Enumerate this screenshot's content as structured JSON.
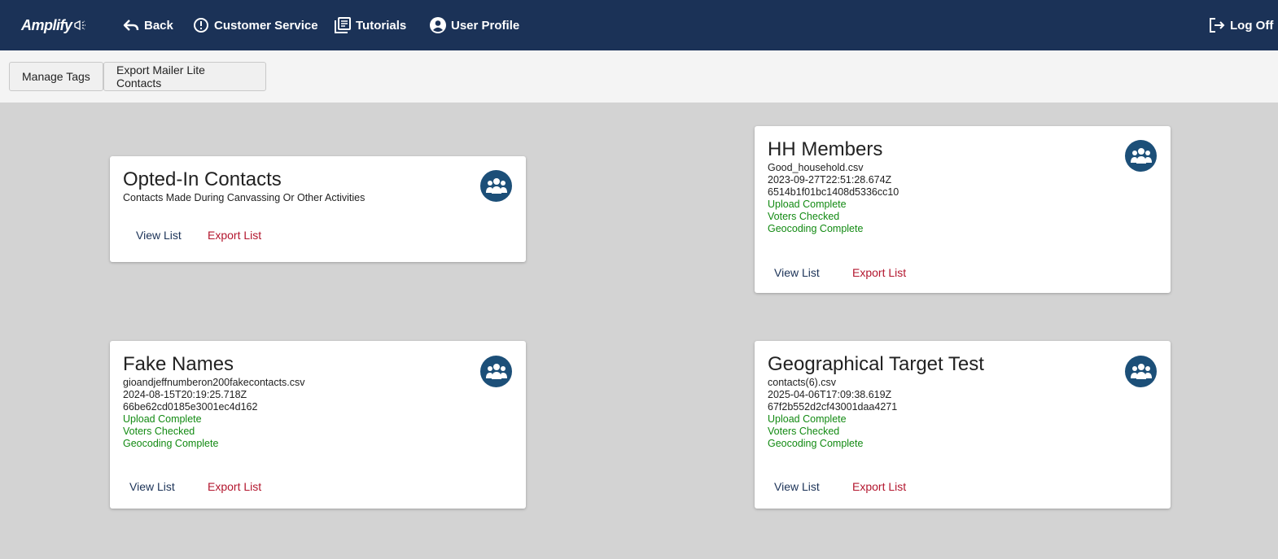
{
  "navbar": {
    "logo_text": "Amplify",
    "back_label": "Back",
    "customer_service_label": "Customer Service",
    "tutorials_label": "Tutorials",
    "user_profile_label": "User Profile",
    "logoff_label": "Log Off"
  },
  "toolbar": {
    "manage_tags_label": "Manage Tags",
    "export_mailer_label": "Export Mailer Lite Contacts"
  },
  "colors": {
    "navbar_bg": "#1b3257",
    "status_green": "#128a12",
    "export_red": "#b3162e",
    "icon_circle": "#1c4f78"
  },
  "cards": [
    {
      "title": "Opted-In Contacts",
      "lines": [
        "Contacts Made During Canvassing Or Other Activities"
      ],
      "statuses": [],
      "view_label": "View List",
      "export_label": "Export List",
      "icon": "group-icon"
    },
    {
      "title": "HH Members",
      "lines": [
        "Good_household.csv",
        "2023-09-27T22:51:28.674Z",
        "6514b1f01bc1408d5336cc10"
      ],
      "statuses": [
        "Upload Complete",
        "Voters Checked",
        "Geocoding Complete"
      ],
      "view_label": "View List",
      "export_label": "Export List",
      "icon": "group-icon"
    },
    {
      "title": "Fake Names",
      "lines": [
        "gioandjeffnumberon200fakecontacts.csv",
        "2024-08-15T20:19:25.718Z",
        "66be62cd0185e3001ec4d162"
      ],
      "statuses": [
        "Upload Complete",
        "Voters Checked",
        "Geocoding Complete"
      ],
      "view_label": "View List",
      "export_label": "Export List",
      "icon": "group-icon"
    },
    {
      "title": "Geographical Target Test",
      "lines": [
        "contacts(6).csv",
        "2025-04-06T17:09:38.619Z",
        "67f2b552d2cf43001daa4271"
      ],
      "statuses": [
        "Upload Complete",
        "Voters Checked",
        "Geocoding Complete"
      ],
      "view_label": "View List",
      "export_label": "Export List",
      "icon": "group-icon"
    }
  ]
}
